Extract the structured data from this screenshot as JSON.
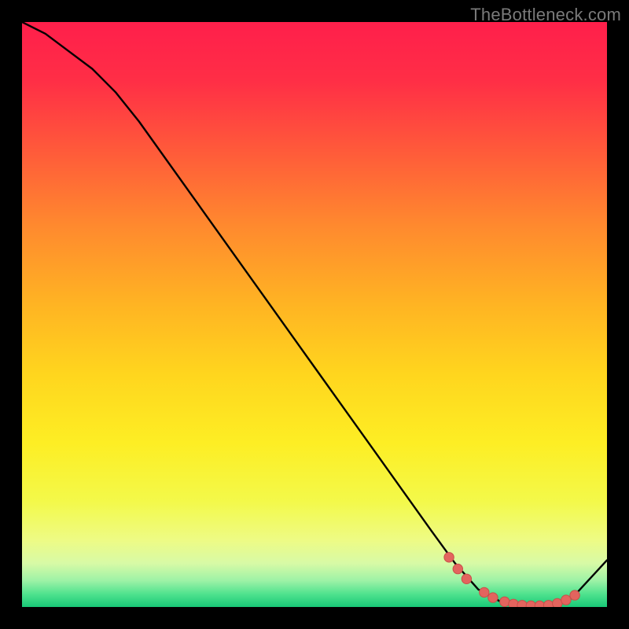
{
  "watermark": "TheBottleneck.com",
  "colors": {
    "curve": "#000000",
    "marker_fill": "#e3645e",
    "marker_stroke": "#c94f49"
  },
  "chart_data": {
    "type": "line",
    "title": "",
    "xlabel": "",
    "ylabel": "",
    "xlim": [
      0,
      100
    ],
    "ylim": [
      0,
      100
    ],
    "x": [
      0,
      4,
      8,
      12,
      16,
      20,
      30,
      40,
      50,
      60,
      70,
      74,
      78,
      82,
      86,
      90,
      94,
      100
    ],
    "values": [
      100,
      98,
      95,
      92,
      88,
      83,
      69,
      55,
      41,
      27,
      13,
      7.5,
      3.0,
      0.8,
      0.2,
      0.2,
      1.5,
      8.0
    ],
    "markers_x": [
      73,
      74.5,
      76,
      79,
      80.5,
      82.5,
      84,
      85.5,
      87,
      88.5,
      90,
      91.5,
      93,
      94.5
    ],
    "markers_y": [
      8.5,
      6.5,
      4.8,
      2.5,
      1.6,
      0.9,
      0.5,
      0.3,
      0.2,
      0.2,
      0.3,
      0.6,
      1.2,
      2.0
    ]
  }
}
